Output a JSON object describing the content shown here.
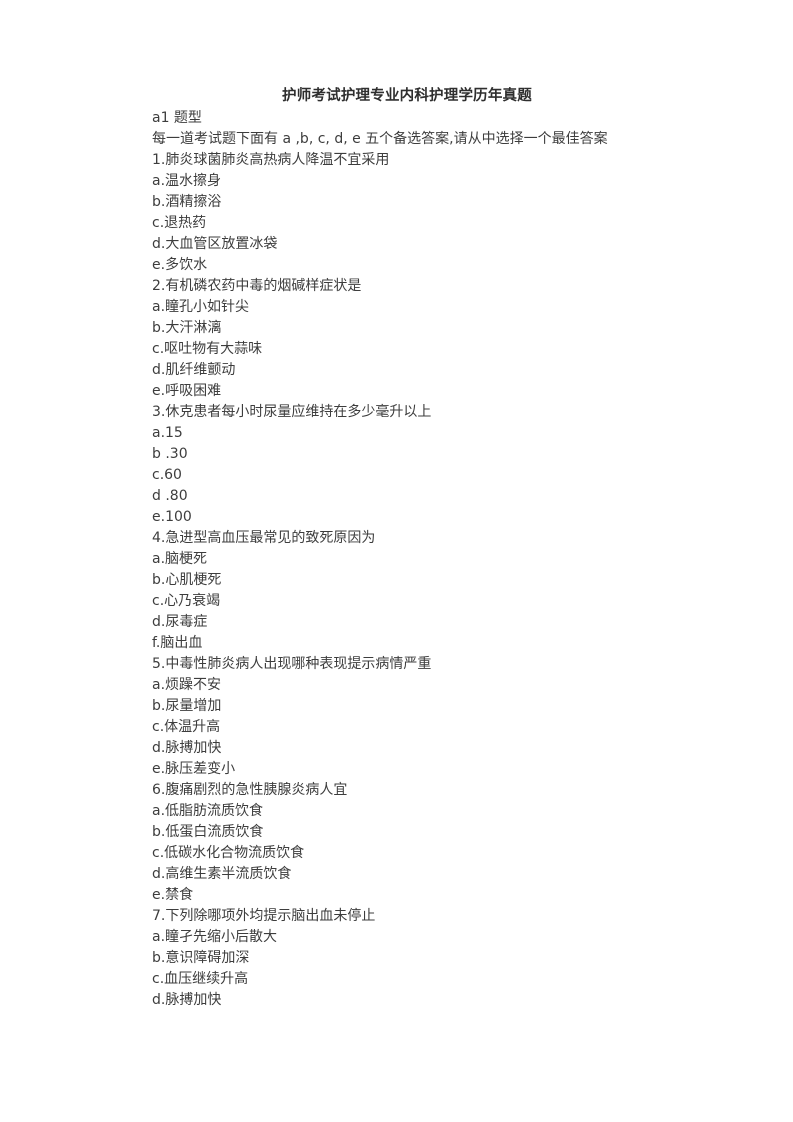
{
  "document": {
    "title": "护师考试护理专业内科护理学历年真题",
    "section_label": "a1 题型",
    "instruction": "每一道考试题下面有 a ,b, c, d, e 五个备选答案,请从中选择一个最佳答案",
    "questions": [
      {
        "stem": "1.肺炎球菌肺炎高热病人降温不宜采用",
        "options": [
          "a.温水擦身",
          "b.酒精擦浴",
          "c.退热药",
          "d.大血管区放置冰袋",
          "e.多饮水"
        ]
      },
      {
        "stem": "2.有机磷农药中毒的烟碱样症状是",
        "options": [
          "a.瞳孔小如针尖",
          "b.大汗淋漓",
          "c.呕吐物有大蒜味",
          "d.肌纤维颤动",
          "e.呼吸困难"
        ]
      },
      {
        "stem": "3.休克患者每小时尿量应维持在多少毫升以上",
        "options": [
          "a.15",
          "b .30",
          "c.60",
          "d .80",
          "e.100"
        ]
      },
      {
        "stem": "4.急进型高血压最常见的致死原因为",
        "options": [
          "a.脑梗死",
          "b.心肌梗死",
          "c.心乃衰竭",
          "d.尿毒症",
          "f.脑出血"
        ]
      },
      {
        "stem": "5.中毒性肺炎病人出现哪种表现提示病情严重",
        "options": [
          "a.烦躁不安",
          "b.尿量增加",
          "c.体温升高",
          "d.脉搏加快",
          "e.脉压差变小"
        ]
      },
      {
        "stem": "6.腹痛剧烈的急性胰腺炎病人宜",
        "options": [
          "a.低脂肪流质饮食",
          "b.低蛋白流质饮食",
          "c.低碳水化合物流质饮食",
          "d.高维生素半流质饮食",
          "e.禁食"
        ]
      },
      {
        "stem": "7.下列除哪项外均提示脑出血未停止",
        "options": [
          "a.瞳孑先缩小后散大",
          "b.意识障碍加深",
          "c.血压继续升高",
          "d.脉搏加快"
        ]
      }
    ]
  }
}
